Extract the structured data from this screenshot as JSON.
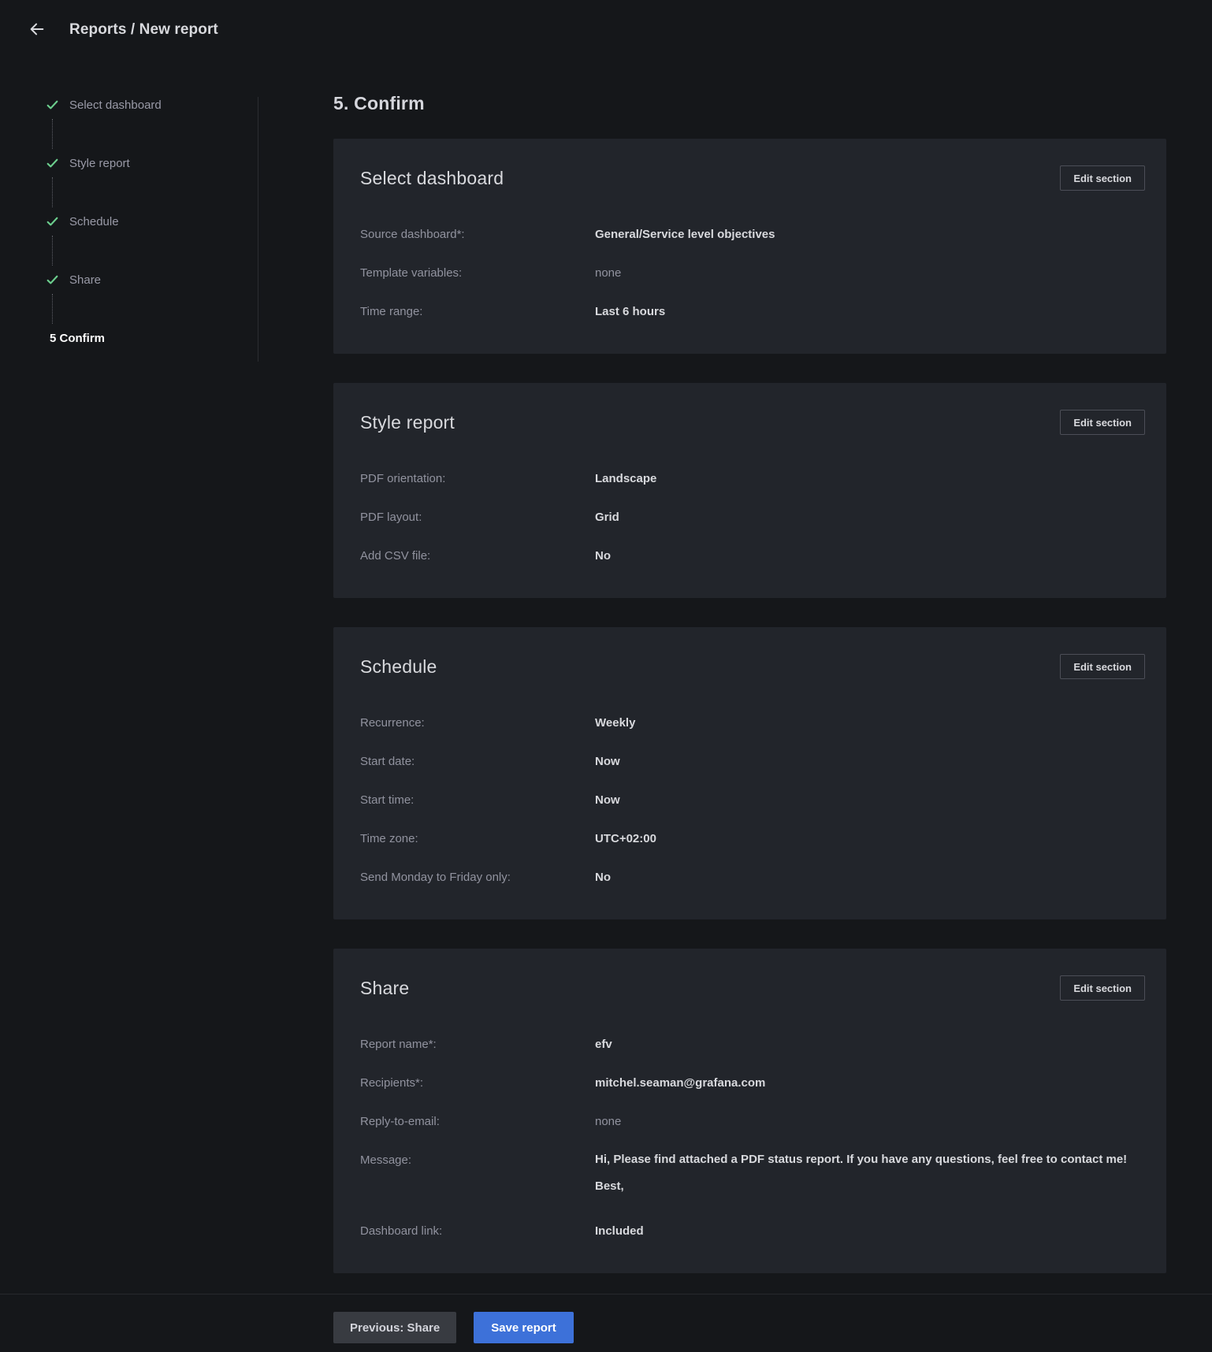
{
  "header": {
    "title": "Reports / New report"
  },
  "stepper": {
    "steps": [
      {
        "label": "Select dashboard",
        "completed": true,
        "active": false
      },
      {
        "label": "Style report",
        "completed": true,
        "active": false
      },
      {
        "label": "Schedule",
        "completed": true,
        "active": false
      },
      {
        "label": "Share",
        "completed": true,
        "active": false
      },
      {
        "label": "5 Confirm",
        "completed": false,
        "active": true
      }
    ]
  },
  "main": {
    "heading": "5. Confirm",
    "edit_button_label": "Edit section",
    "sections": [
      {
        "title": "Select dashboard",
        "rows": [
          {
            "label": "Source dashboard*:",
            "value": "General/Service level objectives",
            "muted": false
          },
          {
            "label": "Template variables:",
            "value": "none",
            "muted": true
          },
          {
            "label": "Time range:",
            "value": "Last 6 hours",
            "muted": false
          }
        ]
      },
      {
        "title": "Style report",
        "rows": [
          {
            "label": "PDF orientation:",
            "value": "Landscape",
            "muted": false
          },
          {
            "label": "PDF layout:",
            "value": "Grid",
            "muted": false
          },
          {
            "label": "Add CSV file:",
            "value": "No",
            "muted": false
          }
        ]
      },
      {
        "title": "Schedule",
        "rows": [
          {
            "label": "Recurrence:",
            "value": "Weekly",
            "muted": false
          },
          {
            "label": "Start date:",
            "value": "Now",
            "muted": false
          },
          {
            "label": "Start time:",
            "value": "Now",
            "muted": false
          },
          {
            "label": "Time zone:",
            "value": "UTC+02:00",
            "muted": false
          },
          {
            "label": "Send Monday to Friday only:",
            "value": "No",
            "muted": false
          }
        ]
      },
      {
        "title": "Share",
        "rows": [
          {
            "label": "Report name*:",
            "value": "efv",
            "muted": false
          },
          {
            "label": "Recipients*:",
            "value": "mitchel.seaman@grafana.com",
            "muted": false
          },
          {
            "label": "Reply-to-email:",
            "value": "none",
            "muted": true
          },
          {
            "label": "Message:",
            "value": "Hi, Please find attached a PDF status report. If you have any questions, feel free to contact me! Best,",
            "muted": false,
            "multiline": true
          },
          {
            "label": "Dashboard link:",
            "value": "Included",
            "muted": false
          }
        ]
      }
    ]
  },
  "footer": {
    "previous_label": "Previous: Share",
    "save_label": "Save report"
  },
  "colors": {
    "page_bg": "#15171a",
    "card_bg": "#22252b",
    "accent_blue": "#3D71D9",
    "success_green": "#6CCF8E",
    "text_primary": "#d8d9dd",
    "text_muted": "rgba(204,204,220,0.65)"
  }
}
